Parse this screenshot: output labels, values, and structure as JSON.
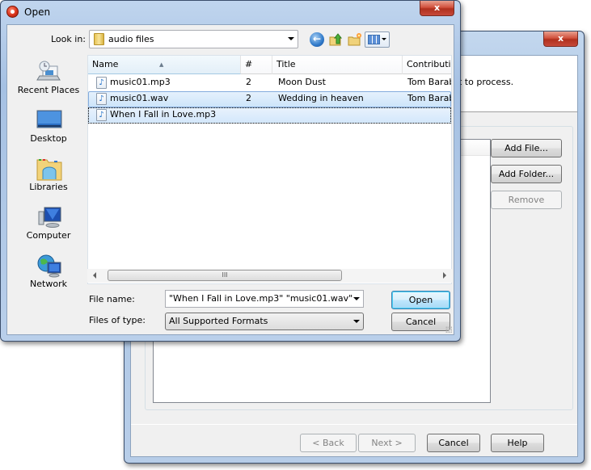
{
  "wizard": {
    "close_label": "x",
    "header_text": "t to process.",
    "buttons": {
      "add_file": "Add File...",
      "add_folder": "Add Folder...",
      "remove": "Remove",
      "back": "< Back",
      "next": "Next >",
      "cancel": "Cancel",
      "help": "Help"
    }
  },
  "dialog": {
    "title": "Open",
    "close_label": "x",
    "look_in_label": "Look in:",
    "look_in_value": "audio files",
    "toolbar": {
      "back_icon": "back-arrow-icon",
      "up_icon": "up-folder-icon",
      "new_folder_icon": "new-folder-icon",
      "views_icon": "views-menu-icon"
    },
    "places": [
      {
        "label": "Recent Places",
        "icon": "recent-places-icon"
      },
      {
        "label": "Desktop",
        "icon": "desktop-icon"
      },
      {
        "label": "Libraries",
        "icon": "libraries-icon"
      },
      {
        "label": "Computer",
        "icon": "computer-icon"
      },
      {
        "label": "Network",
        "icon": "network-icon"
      }
    ],
    "columns": [
      "Name",
      "#",
      "Title",
      "Contributi"
    ],
    "files": [
      {
        "name": "music01.mp3",
        "track": "2",
        "title": "Moon Dust",
        "contrib": "Tom Barab",
        "state": "normal"
      },
      {
        "name": "music01.wav",
        "track": "2",
        "title": "Wedding in heaven",
        "contrib": "Tom Barab",
        "state": "selected"
      },
      {
        "name": "When I Fall in Love.mp3",
        "track": "",
        "title": "",
        "contrib": "",
        "state": "focused"
      }
    ],
    "scroll_thumb_label": "III",
    "file_name_label": "File name:",
    "file_name_value": "\"When I Fall in Love.mp3\" \"music01.wav\"",
    "file_type_label": "Files of type:",
    "file_type_value": "All Supported Formats",
    "open_label": "Open",
    "cancel_label": "Cancel"
  }
}
